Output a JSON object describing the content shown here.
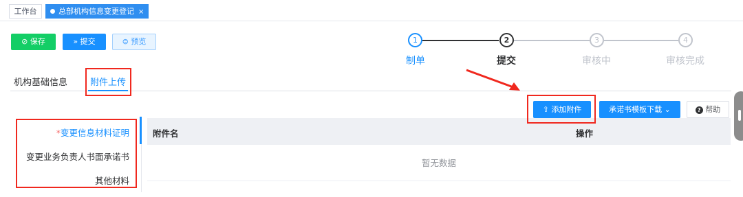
{
  "tabs": {
    "home": "工作台",
    "active": "总部机构信息变更登记",
    "close": "×"
  },
  "actions": {
    "save": "保存",
    "submit": "提交",
    "preview": "预览"
  },
  "steps": [
    {
      "num": "1",
      "label": "制单",
      "state": "done"
    },
    {
      "num": "2",
      "label": "提交",
      "state": "current"
    },
    {
      "num": "3",
      "label": "审核中",
      "state": "pending"
    },
    {
      "num": "4",
      "label": "审核完成",
      "state": "pending"
    }
  ],
  "subtabs": {
    "basic": "机构基础信息",
    "upload": "附件上传"
  },
  "toolbar": {
    "add": "添加附件",
    "template": "承诺书模板下载",
    "help": "帮助"
  },
  "categories": {
    "required_mark": "*",
    "item1": "变更信息材料证明",
    "item2": "变更业务负责人书面承诺书",
    "item3": "其他材料"
  },
  "table": {
    "col_name": "附件名",
    "col_ops": "操作",
    "empty": "暂无数据"
  },
  "colors": {
    "primary": "#1890ff",
    "success": "#13ce66",
    "annotation": "#f0281e"
  }
}
